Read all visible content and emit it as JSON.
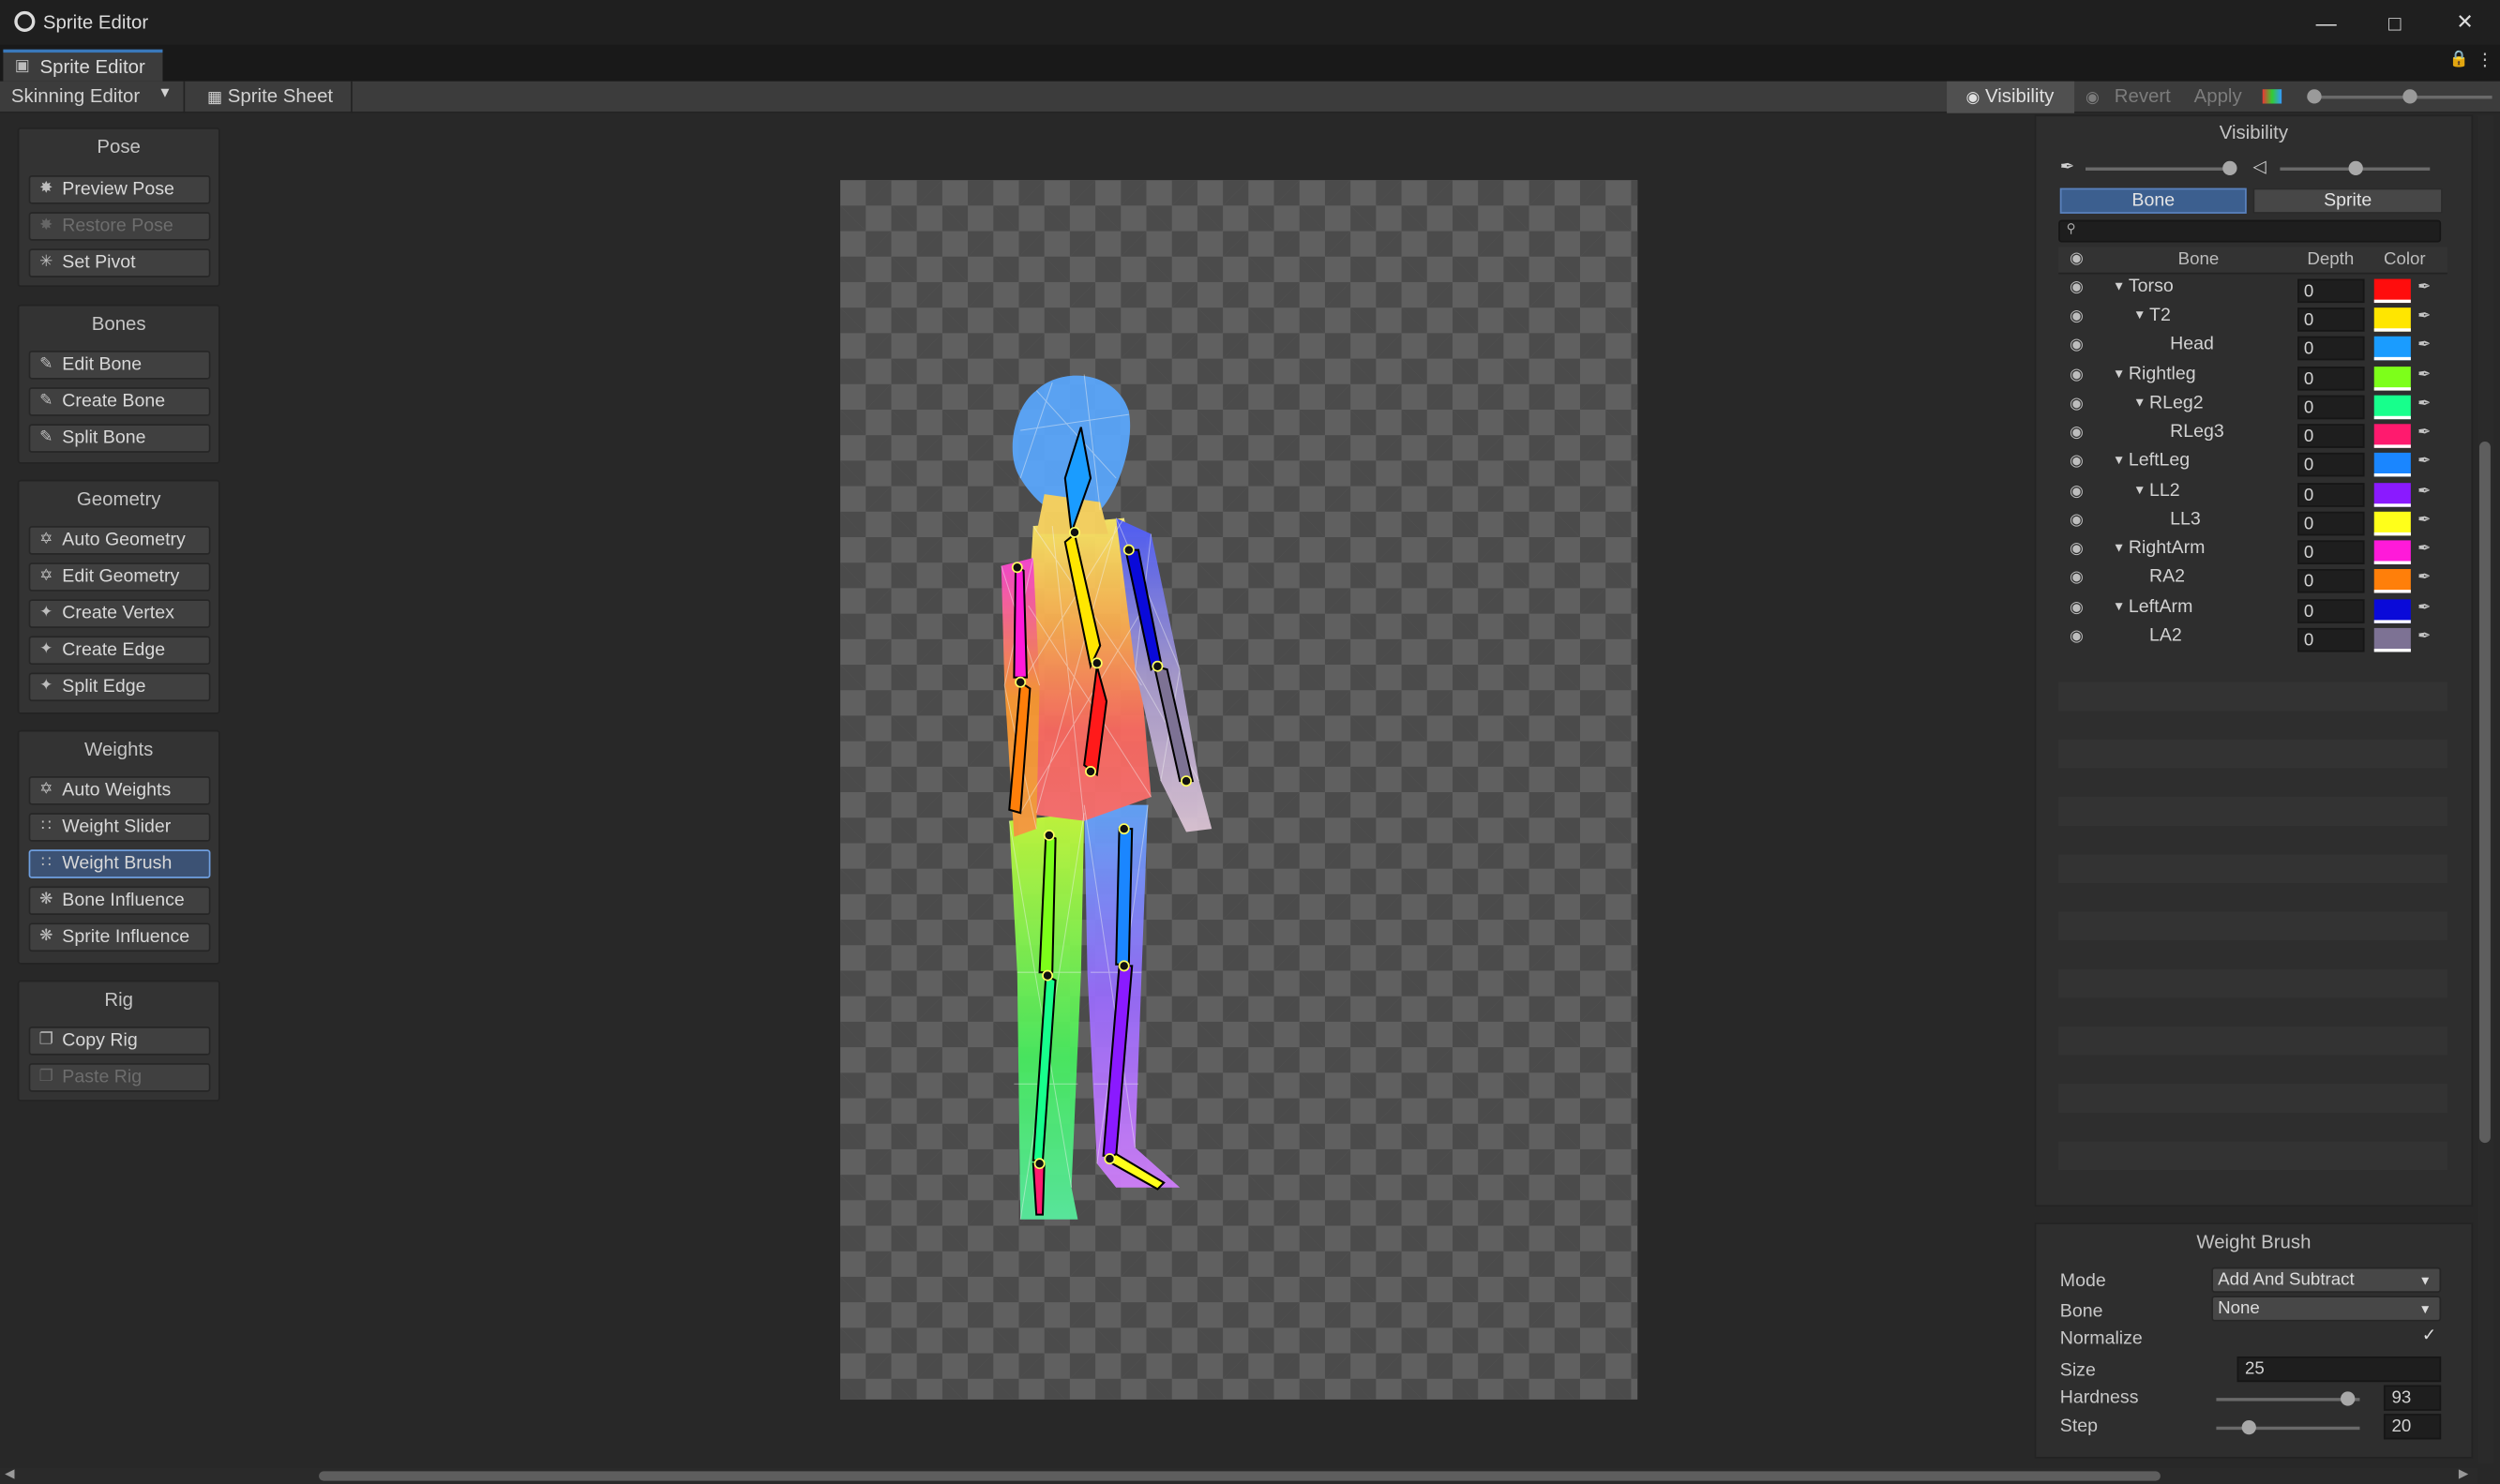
{
  "window": {
    "title": "Sprite Editor",
    "tab": "Sprite Editor"
  },
  "toolbar": {
    "mode": "Skinning Editor",
    "sprite_sheet": "Sprite Sheet",
    "visibility": "Visibility",
    "revert": "Revert",
    "apply": "Apply"
  },
  "pose": {
    "title": "Pose",
    "preview": "Preview Pose",
    "restore": "Restore Pose",
    "pivot": "Set Pivot"
  },
  "bones": {
    "title": "Bones",
    "edit": "Edit Bone",
    "create": "Create Bone",
    "split": "Split Bone"
  },
  "geometry": {
    "title": "Geometry",
    "auto": "Auto Geometry",
    "edit": "Edit Geometry",
    "vertex": "Create Vertex",
    "edge": "Create Edge",
    "split": "Split Edge"
  },
  "weights": {
    "title": "Weights",
    "auto": "Auto Weights",
    "slider": "Weight Slider",
    "brush": "Weight Brush",
    "bone_influence": "Bone Influence",
    "sprite_influence": "Sprite Influence"
  },
  "rig": {
    "title": "Rig",
    "copy": "Copy Rig",
    "paste": "Paste Rig"
  },
  "visibility": {
    "title": "Visibility",
    "tab_bone": "Bone",
    "tab_sprite": "Sprite",
    "col_bone": "Bone",
    "col_depth": "Depth",
    "col_color": "Color",
    "bones": [
      {
        "name": "Torso",
        "depth": "0",
        "color": "#ff0d0d"
      },
      {
        "name": "T2",
        "depth": "0",
        "color": "#ffe600"
      },
      {
        "name": "Head",
        "depth": "0",
        "color": "#1a9cff"
      },
      {
        "name": "Rightleg",
        "depth": "0",
        "color": "#7dff1a"
      },
      {
        "name": "RLeg2",
        "depth": "0",
        "color": "#17ff8c"
      },
      {
        "name": "RLeg3",
        "depth": "0",
        "color": "#ff1a6e"
      },
      {
        "name": "LeftLeg",
        "depth": "0",
        "color": "#1a86ff"
      },
      {
        "name": "LL2",
        "depth": "0",
        "color": "#8a1aff"
      },
      {
        "name": "LL3",
        "depth": "0",
        "color": "#ffff1a"
      },
      {
        "name": "RightArm",
        "depth": "0",
        "color": "#ff1ad9"
      },
      {
        "name": "RA2",
        "depth": "0",
        "color": "#ff7f0a"
      },
      {
        "name": "LeftArm",
        "depth": "0",
        "color": "#0a0ad9"
      },
      {
        "name": "LA2",
        "depth": "0",
        "color": "#7d7294"
      }
    ]
  },
  "weight_brush": {
    "title": "Weight Brush",
    "mode_label": "Mode",
    "mode_value": "Add And Subtract",
    "bone_label": "Bone",
    "bone_value": "None",
    "normalize_label": "Normalize",
    "size_label": "Size",
    "size_value": "25",
    "hardness_label": "Hardness",
    "hardness_value": "93",
    "step_label": "Step",
    "step_value": "20"
  }
}
